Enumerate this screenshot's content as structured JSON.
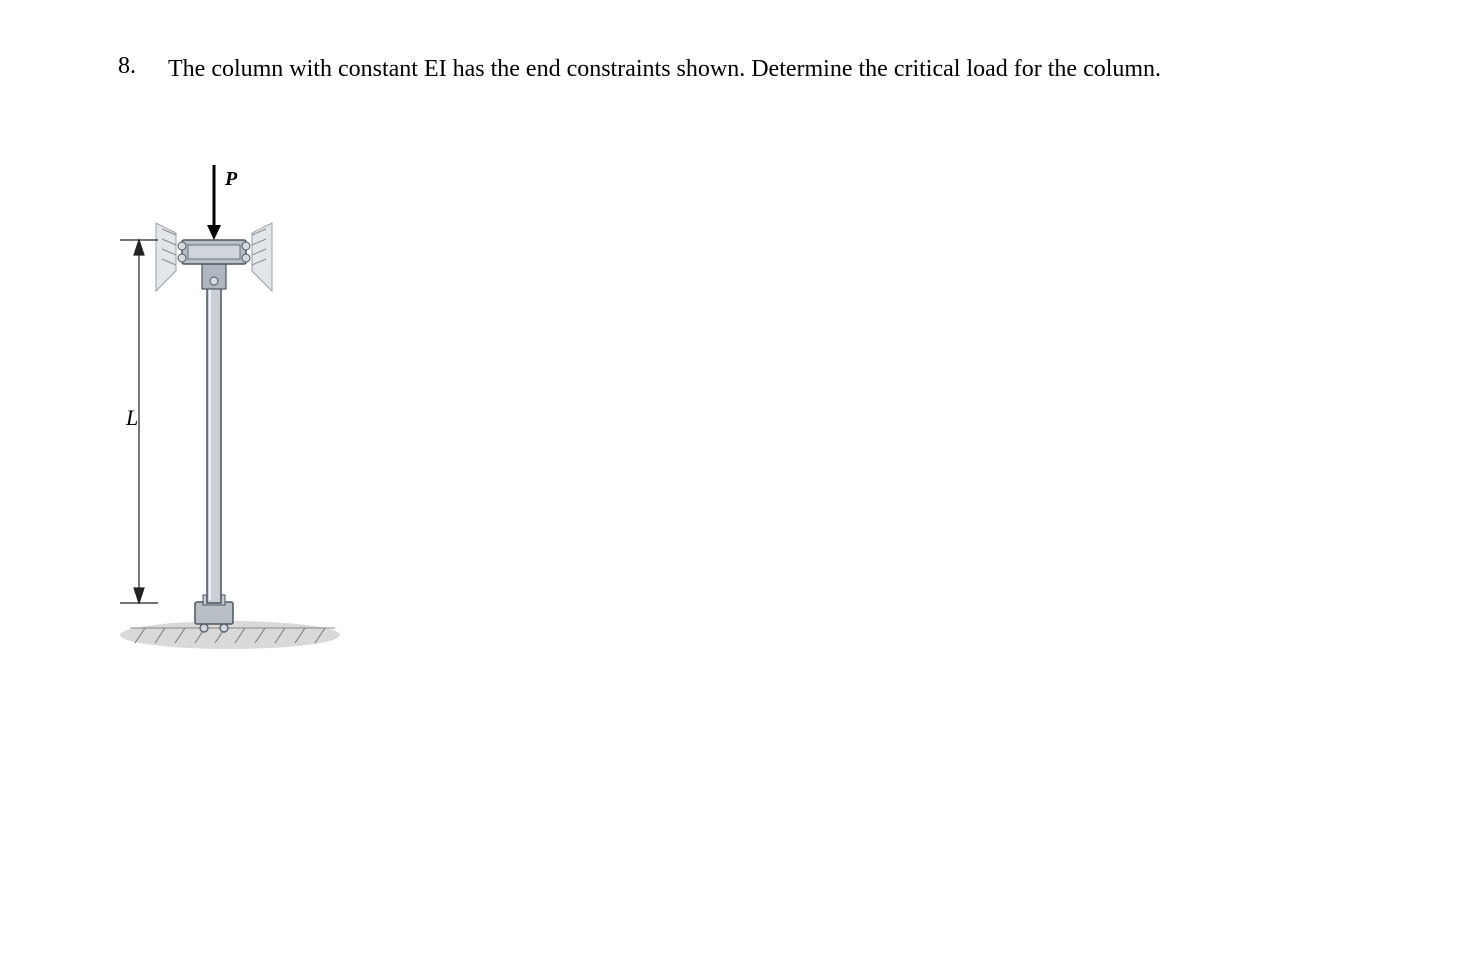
{
  "problem": {
    "number": "8.",
    "text": "The column with constant EI has the end constraints shown. Determine the critical load for the column."
  },
  "figure": {
    "load_label": "P",
    "length_label": "L"
  }
}
